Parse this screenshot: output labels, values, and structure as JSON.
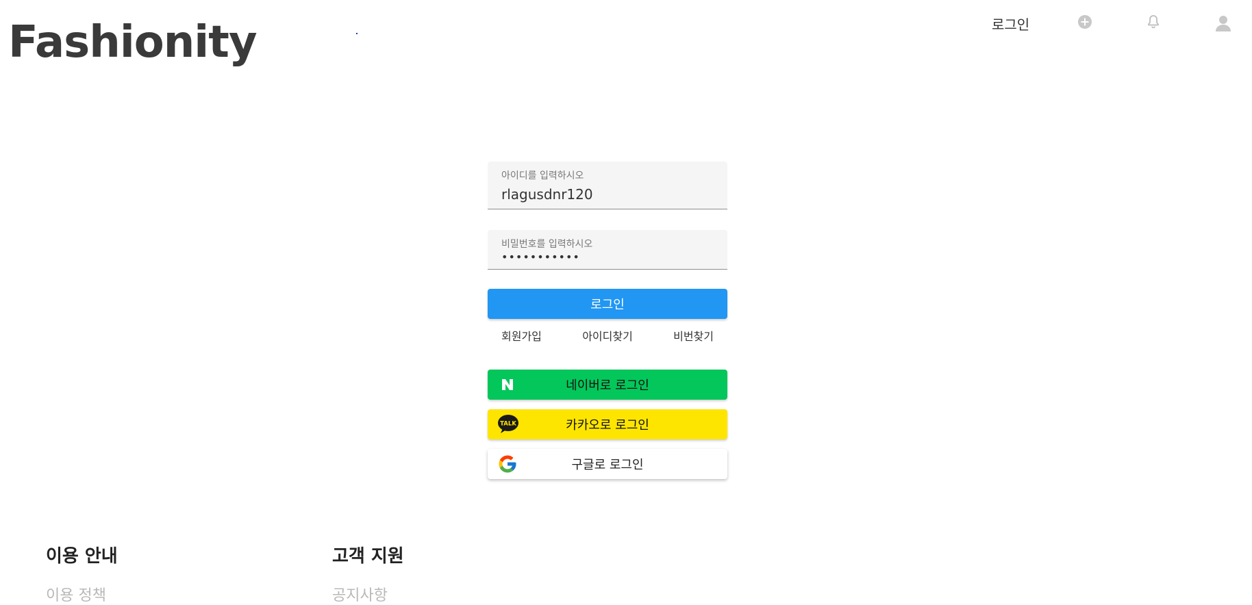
{
  "brand": {
    "logo": "Fashionity"
  },
  "topnav": {
    "login_label": "로그인",
    "icons": [
      "add-circle-icon",
      "bell-icon",
      "user-avatar-icon"
    ]
  },
  "login_form": {
    "id_field": {
      "label": "아이디를 입력하시오",
      "value": "rlagusdnr120"
    },
    "password_field": {
      "label": "비밀번호를 입력하시오",
      "value": "•••••••••••"
    },
    "login_button": "로그인",
    "links": {
      "signup": "회원가입",
      "find_id": "아이디찾기",
      "find_password": "비번찾기"
    },
    "social": {
      "naver": "네이버로 로그인",
      "kakao": "카카오로 로그인",
      "kakao_icon_text": "TALK",
      "google": "구글로 로그인"
    }
  },
  "footer": {
    "columns": [
      {
        "heading": "이용 안내",
        "first_link": "이용 정책"
      },
      {
        "heading": "고객 지원",
        "first_link": "공지사항"
      }
    ]
  },
  "colors": {
    "primary": "#2196f3",
    "naver": "#03c75a",
    "kakao": "#fee500",
    "footer_link": "#b8b8b8"
  }
}
